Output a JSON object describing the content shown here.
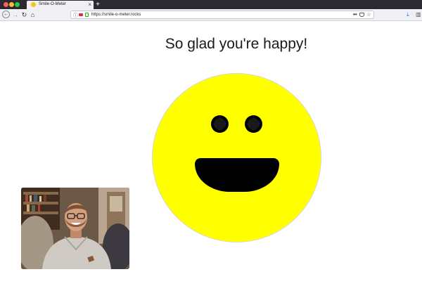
{
  "browser": {
    "tab_title": "Smile-O-Meter",
    "tab_close": "×",
    "new_tab": "+",
    "url": "https://smile-o-meter.rocks",
    "icons": {
      "back": "←",
      "forward": "→",
      "reload": "↻",
      "home": "⌂",
      "info": "ⓘ",
      "more": "•••",
      "star": "☆",
      "download": "⤓",
      "library": "▥"
    }
  },
  "page": {
    "headline": "So glad you're happy!",
    "smiley_color": "#ffff00"
  }
}
